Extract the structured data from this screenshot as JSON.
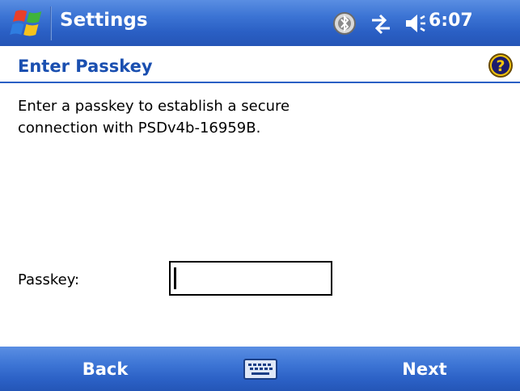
{
  "titlebar": {
    "app_title": "Settings",
    "clock": "6:07",
    "icons": [
      "start-menu-flag-icon",
      "bluetooth-status-icon",
      "connectivity-icon",
      "volume-icon"
    ]
  },
  "header": {
    "title": "Enter Passkey",
    "help_icon": "help-icon"
  },
  "body": {
    "instructions_line1": "Enter a passkey to establish a secure",
    "instructions_line2": "connection with PSDv4b-16959B.",
    "passkey_label": "Passkey:",
    "passkey_value": ""
  },
  "softkeys": {
    "left_label": "Back",
    "right_label": "Next",
    "center_icon": "keyboard-icon"
  },
  "colors": {
    "bar_blue": "#2a5fc4",
    "title_text_blue": "#1a4fb0",
    "help_yellow": "#f2c40f"
  }
}
